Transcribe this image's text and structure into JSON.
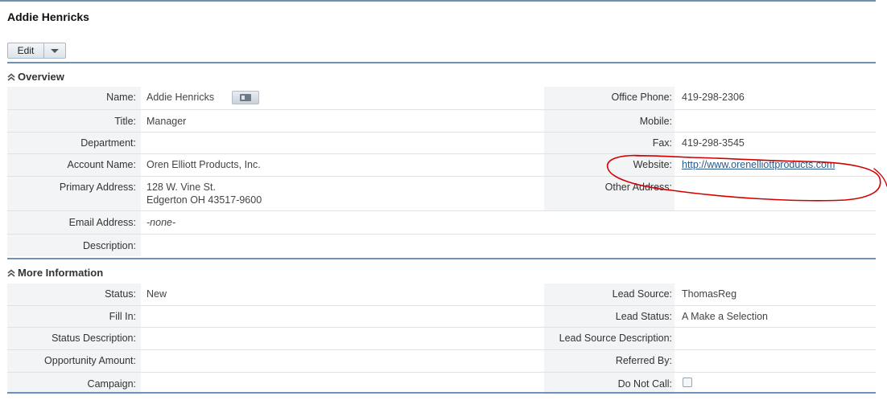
{
  "page": {
    "title": "Addie Henricks",
    "edit_label": "Edit"
  },
  "overview": {
    "heading": "Overview",
    "rows": [
      {
        "left_label": "Name:",
        "left_value": "Addie Henricks",
        "right_label": "Office Phone:",
        "right_value": "419-298-2306"
      },
      {
        "left_label": "Title:",
        "left_value": "Manager",
        "right_label": "Mobile:",
        "right_value": ""
      },
      {
        "left_label": "Department:",
        "left_value": "",
        "right_label": "Fax:",
        "right_value": "419-298-3545"
      },
      {
        "left_label": "Account Name:",
        "left_value": "Oren Elliott Products, Inc.",
        "right_label": "Website:",
        "right_value": "http://www.orenelliottproducts.com"
      },
      {
        "left_label": "Primary Address:",
        "left_value": "128 W. Vine St.",
        "left_value_2": "Edgerton OH  43517-9600",
        "right_label": "Other Address:",
        "right_value": ""
      },
      {
        "left_label": "Email Address:",
        "left_value": "-none-"
      },
      {
        "left_label": "Description:",
        "left_value": ""
      }
    ]
  },
  "more_info": {
    "heading": "More Information",
    "rows": [
      {
        "left_label": "Status:",
        "left_value": "New",
        "right_label": "Lead Source:",
        "right_value": "ThomasReg"
      },
      {
        "left_label": "Fill In:",
        "left_value": "",
        "right_label": "Lead Status:",
        "right_value": "A Make a Selection"
      },
      {
        "left_label": "Status Description:",
        "left_value": "",
        "right_label": "Lead Source Description:",
        "right_value": ""
      },
      {
        "left_label": "Opportunity Amount:",
        "left_value": "",
        "right_label": "Referred By:",
        "right_value": ""
      },
      {
        "left_label": "Campaign:",
        "left_value": "",
        "right_label": "Do Not Call:",
        "right_value": ""
      }
    ]
  },
  "do_not_call_checked": false,
  "colors": {
    "accent_rule": "#6f93b8",
    "label_bg": "#f3f4f5",
    "link": "#2a5a8a",
    "annotation": "#d40000"
  }
}
